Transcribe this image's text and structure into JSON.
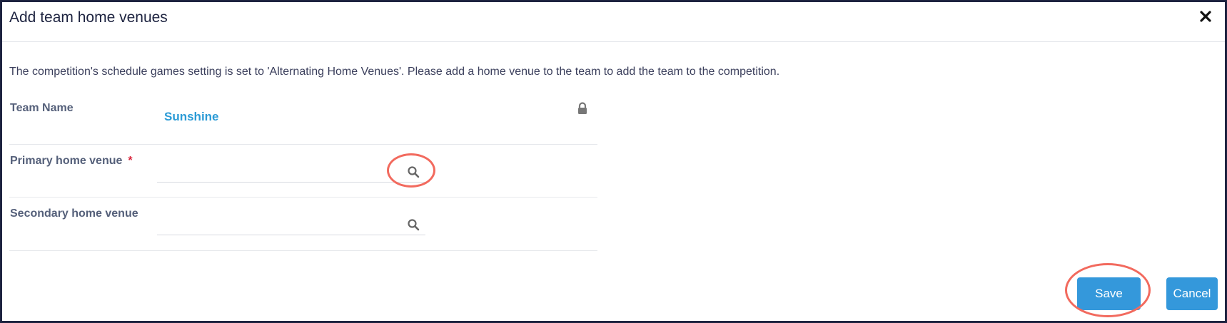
{
  "dialog": {
    "title": "Add team home venues",
    "close_icon": "close-icon"
  },
  "notice": "The competition's schedule games setting is set to 'Alternating Home Venues'. Please add a home venue to the team to add the team to the competition.",
  "form": {
    "team": {
      "label": "Team Name",
      "value": "Sunshine",
      "lock_icon": "lock-icon"
    },
    "primary": {
      "label": "Primary home venue",
      "required_marker": "*",
      "value": "",
      "search_icon": "search-icon"
    },
    "secondary": {
      "label": "Secondary home venue",
      "value": "",
      "search_icon": "search-icon"
    }
  },
  "buttons": {
    "save_label": "Save",
    "cancel_label": "Cancel"
  },
  "colors": {
    "accent": "#3498db",
    "link": "#2b9bd6",
    "required": "#d9243b",
    "highlight": "#f26a5e",
    "frame": "#1d2340"
  }
}
